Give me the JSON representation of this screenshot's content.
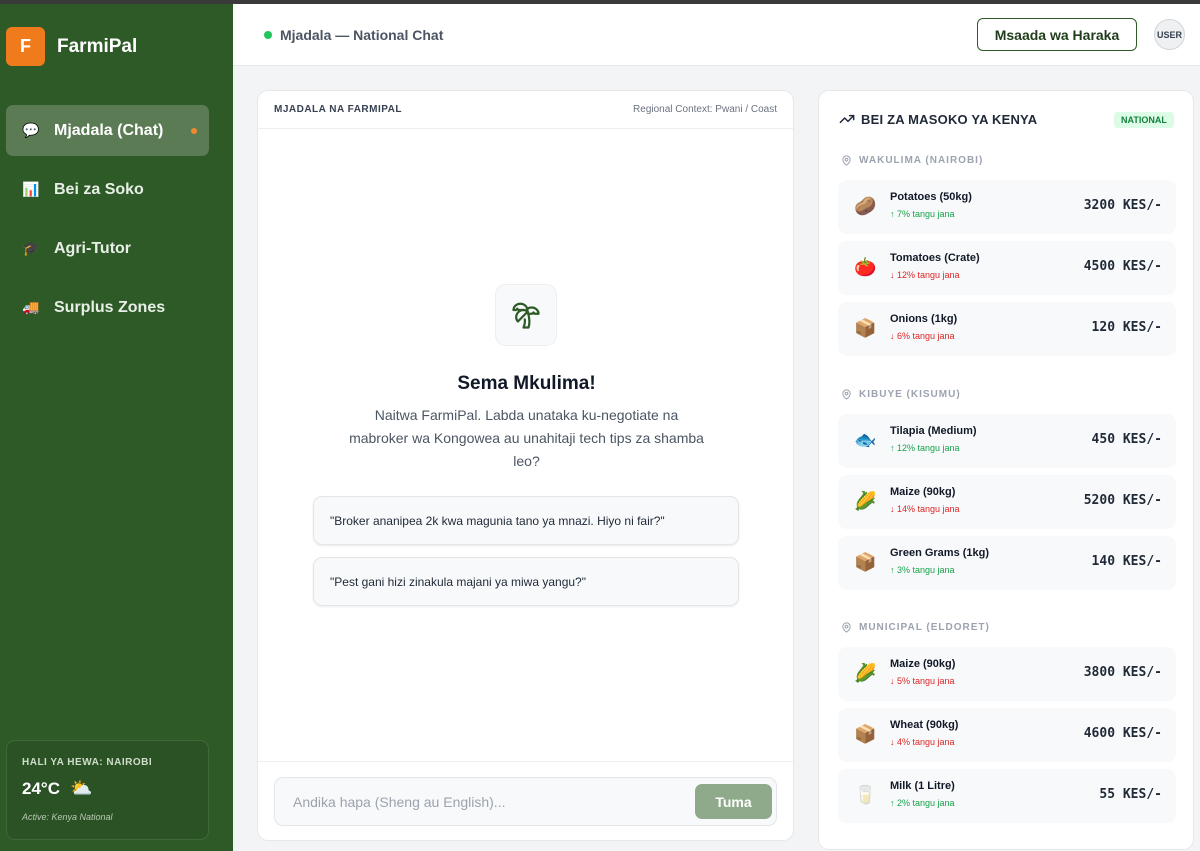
{
  "app": {
    "logo_letter": "F",
    "name": "FarmiPal"
  },
  "nav": [
    {
      "label": "Mjadala (Chat)",
      "icon": "💬",
      "icon_name": "chat-bubble-icon",
      "active": true
    },
    {
      "label": "Bei za Soko",
      "icon": "📊",
      "icon_name": "bar-chart-icon",
      "active": false
    },
    {
      "label": "Agri-Tutor",
      "icon": "🎓",
      "icon_name": "graduation-cap-icon",
      "active": false
    },
    {
      "label": "Surplus Zones",
      "icon": "🚚",
      "icon_name": "truck-icon",
      "active": false
    }
  ],
  "weather": {
    "title": "HALI YA HEWA: NAIROBI",
    "temp": "24°C",
    "icon": "⛅",
    "active": "Active: Kenya National"
  },
  "header": {
    "title": "Mjadala — National Chat",
    "help_label": "Msaada wa Haraka",
    "user_label": "USER"
  },
  "chat": {
    "title": "MJADALA NA FARMIPAL",
    "context": "Regional Context: Pwani / Coast",
    "greeting": "Sema Mkulima!",
    "intro": "Naitwa FarmiPal. Labda unataka ku-negotiate na mabroker wa Kongowea au unahitaji tech tips za shamba leo?",
    "suggestions": [
      "\"Broker ananipea 2k kwa magunia tano ya mnazi. Hiyo ni fair?\"",
      "\"Pest gani hizi zinakula majani ya miwa yangu?\""
    ],
    "input_placeholder": "Andika hapa (Sheng au English)...",
    "send_label": "Tuma"
  },
  "market": {
    "title": "BEI ZA MASOKO YA KENYA",
    "badge": "NATIONAL",
    "regions": [
      {
        "label": "WAKULIMA (NAIROBI)",
        "items": [
          {
            "emoji": "🥔",
            "name": "Potatoes (50kg)",
            "change": "↑ 7% tangu jana",
            "dir": "up",
            "price": "3200 KES/-"
          },
          {
            "emoji": "🍅",
            "name": "Tomatoes (Crate)",
            "change": "↓ 12% tangu jana",
            "dir": "down",
            "price": "4500 KES/-"
          },
          {
            "emoji": "📦",
            "name": "Onions (1kg)",
            "change": "↓ 6% tangu jana",
            "dir": "down",
            "price": "120 KES/-"
          }
        ]
      },
      {
        "label": "KIBUYE (KISUMU)",
        "items": [
          {
            "emoji": "🐟",
            "name": "Tilapia (Medium)",
            "change": "↑ 12% tangu jana",
            "dir": "up",
            "price": "450 KES/-"
          },
          {
            "emoji": "🌽",
            "name": "Maize (90kg)",
            "change": "↓ 14% tangu jana",
            "dir": "down",
            "price": "5200 KES/-"
          },
          {
            "emoji": "📦",
            "name": "Green Grams (1kg)",
            "change": "↑ 3% tangu jana",
            "dir": "up",
            "price": "140 KES/-"
          }
        ]
      },
      {
        "label": "MUNICIPAL (ELDORET)",
        "items": [
          {
            "emoji": "🌽",
            "name": "Maize (90kg)",
            "change": "↓ 5% tangu jana",
            "dir": "down",
            "price": "3800 KES/-"
          },
          {
            "emoji": "📦",
            "name": "Wheat (90kg)",
            "change": "↓ 4% tangu jana",
            "dir": "down",
            "price": "4600 KES/-"
          },
          {
            "emoji": "🥛",
            "name": "Milk (1 Litre)",
            "change": "↑ 2% tangu jana",
            "dir": "up",
            "price": "55 KES/-"
          }
        ]
      }
    ]
  },
  "colors": {
    "sidebar": "#2e5a27",
    "accent": "#f07b1d",
    "up": "#16a34a",
    "down": "#dc2626",
    "online": "#22c55e"
  }
}
